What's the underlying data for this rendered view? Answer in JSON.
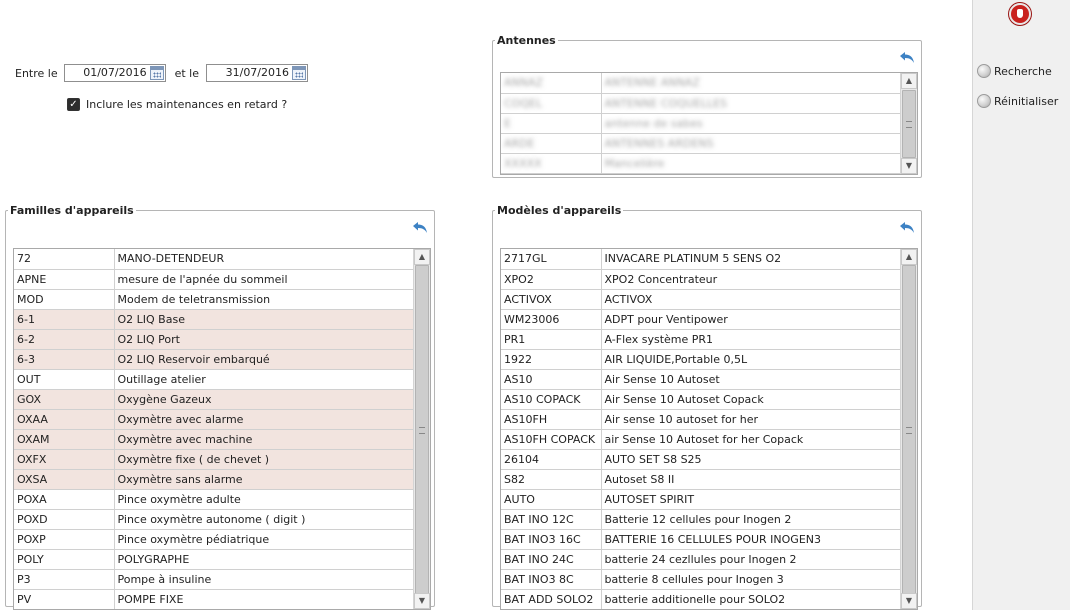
{
  "dates": {
    "between_label": "Entre le",
    "and_label": "et le",
    "start_value": "01/07/2016",
    "end_value": "31/07/2016"
  },
  "include_late": {
    "label": "Inclure les maintenances en retard ?",
    "checked": true
  },
  "antennes": {
    "title": "Antennes",
    "rows": [
      [
        "ANNAZ",
        "ANTENNE ANNAZ"
      ],
      [
        "COQEL",
        "ANTENNE COQUELLES"
      ],
      [
        "E",
        "antenne de sabes"
      ],
      [
        "ARDE",
        "ANTENNES ARDENS"
      ],
      [
        "XXXXX",
        "Mancelière"
      ]
    ]
  },
  "familles": {
    "title": "Familles d'appareils",
    "rows": [
      {
        "code": "72",
        "label": "MANO-DETENDEUR",
        "selected": false
      },
      {
        "code": "APNE",
        "label": "mesure de l'apnée du sommeil",
        "selected": false
      },
      {
        "code": "MOD",
        "label": "Modem de teletransmission",
        "selected": false
      },
      {
        "code": "6-1",
        "label": "O2 LIQ Base",
        "selected": true
      },
      {
        "code": "6-2",
        "label": "O2 LIQ Port",
        "selected": true
      },
      {
        "code": "6-3",
        "label": "O2 LIQ Reservoir embarqué",
        "selected": true
      },
      {
        "code": "OUT",
        "label": "Outillage atelier",
        "selected": false
      },
      {
        "code": "GOX",
        "label": "Oxygène Gazeux",
        "selected": true
      },
      {
        "code": "OXAA",
        "label": "Oxymètre avec alarme",
        "selected": true
      },
      {
        "code": "OXAM",
        "label": "Oxymètre avec machine",
        "selected": true
      },
      {
        "code": "OXFX",
        "label": "Oxymètre fixe ( de chevet )",
        "selected": true
      },
      {
        "code": "OXSA",
        "label": "Oxymètre sans alarme",
        "selected": true
      },
      {
        "code": "POXA",
        "label": "Pince oxymètre adulte",
        "selected": false
      },
      {
        "code": "POXD",
        "label": "Pince oxymètre autonome ( digit )",
        "selected": false
      },
      {
        "code": "POXP",
        "label": "Pince oxymètre pédiatrique",
        "selected": false
      },
      {
        "code": "POLY",
        "label": "POLYGRAPHE",
        "selected": false
      },
      {
        "code": "P3",
        "label": "Pompe à insuline",
        "selected": false
      },
      {
        "code": "PV",
        "label": "POMPE FIXE",
        "selected": false
      }
    ]
  },
  "modeles": {
    "title": "Modèles d'appareils",
    "rows": [
      {
        "code": "2717GL",
        "label": " INVACARE PLATINUM 5 SENS O2"
      },
      {
        "code": "XPO2",
        "label": " XPO2 Concentrateur"
      },
      {
        "code": "ACTIVOX",
        "label": "ACTIVOX"
      },
      {
        "code": "WM23006",
        "label": "ADPT pour Ventipower"
      },
      {
        "code": "PR1",
        "label": "A-Flex système PR1"
      },
      {
        "code": "1922",
        "label": "AIR LIQUIDE,Portable 0,5L"
      },
      {
        "code": "AS10",
        "label": "Air Sense 10 Autoset"
      },
      {
        "code": "AS10 COPACK",
        "label": "Air Sense 10 Autoset Copack"
      },
      {
        "code": "AS10FH",
        "label": "Air sense 10 autoset for her"
      },
      {
        "code": "AS10FH COPACK",
        "label": "air Sense 10 Autoset for her Copack"
      },
      {
        "code": "26104",
        "label": "AUTO SET S8 S25"
      },
      {
        "code": "S82",
        "label": "Autoset S8 II"
      },
      {
        "code": "AUTO",
        "label": "AUTOSET SPIRIT"
      },
      {
        "code": "BAT INO 12C",
        "label": "Batterie 12 cellules pour Inogen 2"
      },
      {
        "code": "BAT INO3 16C",
        "label": "BATTERIE 16 CELLULES POUR INOGEN3"
      },
      {
        "code": "BAT INO 24C",
        "label": "batterie 24 cezllules pour Inogen 2"
      },
      {
        "code": "BAT INO3 8C",
        "label": "batterie 8 cellules pour Inogen 3"
      },
      {
        "code": "BAT ADD SOLO2",
        "label": "batterie additionelle pour SOLO2"
      }
    ]
  },
  "sidebar": {
    "search_label": "Recherche",
    "reset_label": "Réinitialiser"
  },
  "colors": {
    "selected_row": "#f2e4df",
    "back_arrow": "#3d82c4",
    "stop_icon": "#c9221f"
  }
}
